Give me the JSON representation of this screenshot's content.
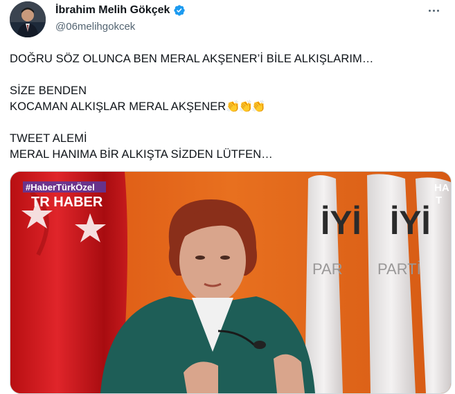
{
  "author": {
    "name": "İbrahim Melih Gökçek",
    "handle": "@06melihgokcek"
  },
  "tweet": {
    "line1": "DOĞRU SÖZ OLUNCA BEN MERAL AKŞENER’İ BİLE ALKIŞLARIM…",
    "line2": "SİZE BENDEN",
    "line3": "KOCAMAN ALKIŞLAR MERAL AKŞENER",
    "claps": "👏👏👏",
    "line4": "TWEET ALEMİ",
    "line5": "MERAL HANIMA BİR ALKIŞTA SİZDEN LÜTFEN…"
  },
  "media": {
    "overlay_tag": "#HaberTürkÖzel",
    "channel_logo": "TR HABER",
    "corner_text_top": "HA",
    "corner_text_bottom": "T",
    "party_logo_left": "İYİ",
    "party_logo_left_sub": "PAR",
    "party_logo_right": "İYİ",
    "party_logo_right_sub": "PARTİ"
  },
  "colors": {
    "verified_blue": "#1d9bf0",
    "handle_gray": "#536471",
    "flag_red": "#d91b1b",
    "background_orange": "#e2611a"
  },
  "icons": [
    "verified-badge-icon",
    "more-options-icon",
    "clapping-hands-icon"
  ]
}
